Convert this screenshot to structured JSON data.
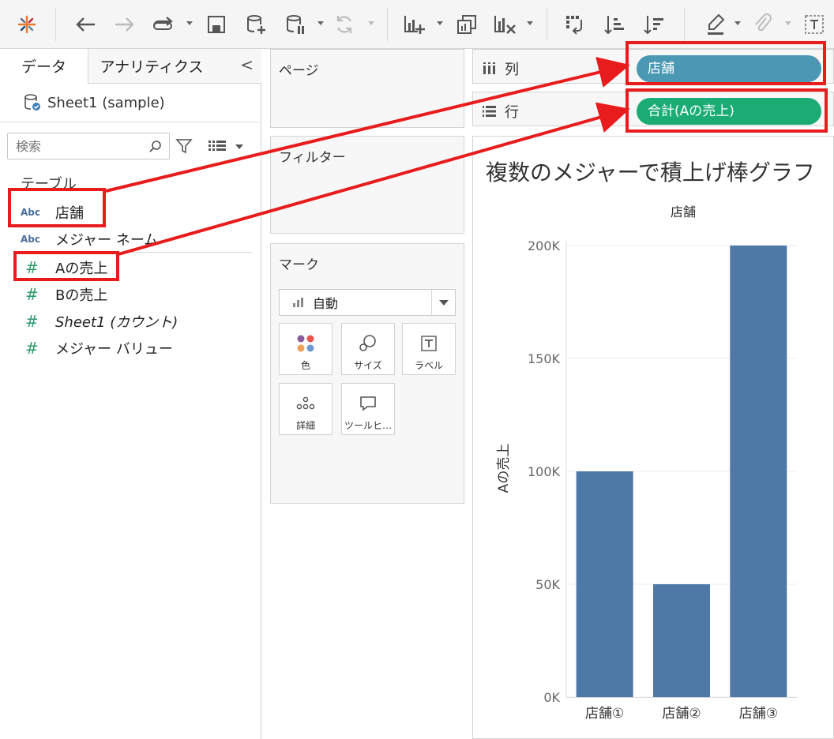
{
  "left_pane": {
    "tabs": [
      "データ",
      "アナリティクス"
    ],
    "collapse": "<",
    "datasource": "Sheet1 (sample)",
    "search_placeholder": "検索",
    "tables_header": "テーブル",
    "dimensions": [
      {
        "type_label": "Abc",
        "name": "店舗"
      },
      {
        "type_label": "Abc",
        "name": "メジャー ネーム"
      }
    ],
    "measures": [
      {
        "type_label": "#",
        "name": "Aの売上"
      },
      {
        "type_label": "#",
        "name": "Bの売上"
      },
      {
        "type_label": "#",
        "name": "Sheet1 (カウント)"
      },
      {
        "type_label": "#",
        "name": "メジャー バリュー"
      }
    ]
  },
  "cards": {
    "pages": "ページ",
    "filters": "フィルター",
    "marks": "マーク",
    "mark_type": "自動",
    "mark_buttons": [
      "色",
      "サイズ",
      "ラベル",
      "詳細",
      "ツールヒ…"
    ]
  },
  "shelves": {
    "columns_label": "列",
    "rows_label": "行",
    "columns_pill": "店舗",
    "rows_pill": "合計(Aの売上)"
  },
  "colors": {
    "bar": "#4e79a7",
    "dimension_pill": "#4a98b4",
    "measure_pill": "#1bac76",
    "highlight": "#e81c1c"
  },
  "chart_data": {
    "type": "bar",
    "title": "複数のメジャーで積上げ棒グラフ",
    "header": "店舗",
    "categories": [
      "店舗①",
      "店舗②",
      "店舗③"
    ],
    "values": [
      100000,
      50000,
      200000
    ],
    "ylabel": "Aの売上",
    "ylim": [
      0,
      200000
    ],
    "yticks": [
      0,
      50000,
      100000,
      150000,
      200000
    ],
    "ytick_labels": [
      "0K",
      "50K",
      "100K",
      "150K",
      "200K"
    ],
    "grid": true
  }
}
